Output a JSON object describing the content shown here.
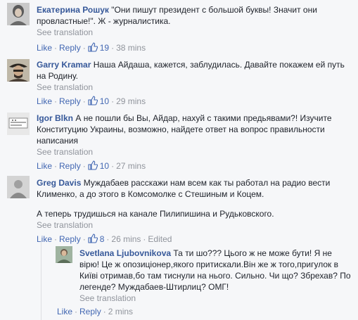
{
  "comments": [
    {
      "author": "Екатерина Рошук",
      "text": "\"Они пишут президент с большой буквы! Значит они провластные!\". Ж - журналистика.",
      "see_translation": "See translation",
      "like": "Like",
      "reply": "Reply",
      "likes": "19",
      "time": "38 mins"
    },
    {
      "author": "Garry Kramar",
      "text": "Наша Айдаша, кажется, заблудилась. Давайте покажем ей путь на Родину.",
      "see_translation": "See translation",
      "like": "Like",
      "reply": "Reply",
      "likes": "10",
      "time": "29 mins"
    },
    {
      "author": "Igor Blkn",
      "text": "А не пошли бы Вы, Айдар, нахуй с такими предьявами?! Изучите Конституцию Украины, возможно, найдете ответ на вопрос правильности написания",
      "see_translation": "See translation",
      "like": "Like",
      "reply": "Reply",
      "likes": "10",
      "time": "27 mins"
    },
    {
      "author": "Greg Davis",
      "text": "Муждабаев расскажи нам всем как ты работал на радио вести Клименко, а до этого в Комсомолке с Стешиным и Коцем.",
      "text2": "А теперь трудишься на канале Пилипишина и Рудьковского.",
      "see_translation": "See translation",
      "like": "Like",
      "reply": "Reply",
      "likes": "8",
      "time": "26 mins",
      "edited": "Edited"
    },
    {
      "author": "Svetlana Ljubovnikova",
      "text": "Та ти шо??? Цього ж не може бути! Я не вірю! Це ж опозиціонер,якого притискали.Він же ж того,пригулок в Київі отримав,бо там тиснули на нього. Сильно. Чи що? Збрехав? По легенде? Муждабаев-Штирлиц? ОМГ!",
      "see_translation": "See translation",
      "like": "Like",
      "reply": "Reply",
      "time": "2 mins"
    }
  ],
  "colors": {
    "author": "#365899",
    "link": "#4267b2",
    "meta": "#90949c",
    "text": "#1d2129",
    "background": "#f6f7f9"
  }
}
